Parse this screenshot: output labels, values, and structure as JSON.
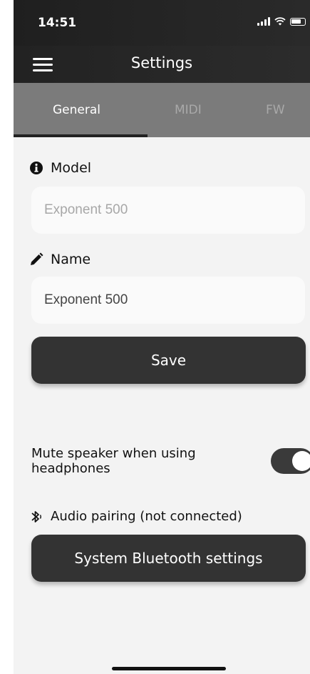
{
  "status_bar": {
    "time": "14:51",
    "icons": [
      "signal-icon",
      "wifi-icon",
      "battery-icon"
    ]
  },
  "header": {
    "title": "Settings",
    "menu_icon": "hamburger-icon"
  },
  "tabs": [
    {
      "label": "General",
      "active": true
    },
    {
      "label": "MIDI",
      "active": false
    },
    {
      "label": "FW",
      "active": false
    }
  ],
  "model": {
    "label": "Model",
    "icon": "info-icon",
    "value": "Exponent 500"
  },
  "name": {
    "label": "Name",
    "icon": "pencil-icon",
    "value": "Exponent 500"
  },
  "save_button": "Save",
  "mute_setting": {
    "label": "Mute speaker when using headphones",
    "enabled": true
  },
  "audio_pairing": {
    "icon": "bluetooth-icon",
    "label": "Audio pairing (not connected)"
  },
  "bluetooth_button": "System Bluetooth settings",
  "colors": {
    "header_bg": "#2a2a2a",
    "tab_bar_bg": "#7b7b7b",
    "button_bg": "#333333",
    "page_bg": "#f3f3f3"
  }
}
